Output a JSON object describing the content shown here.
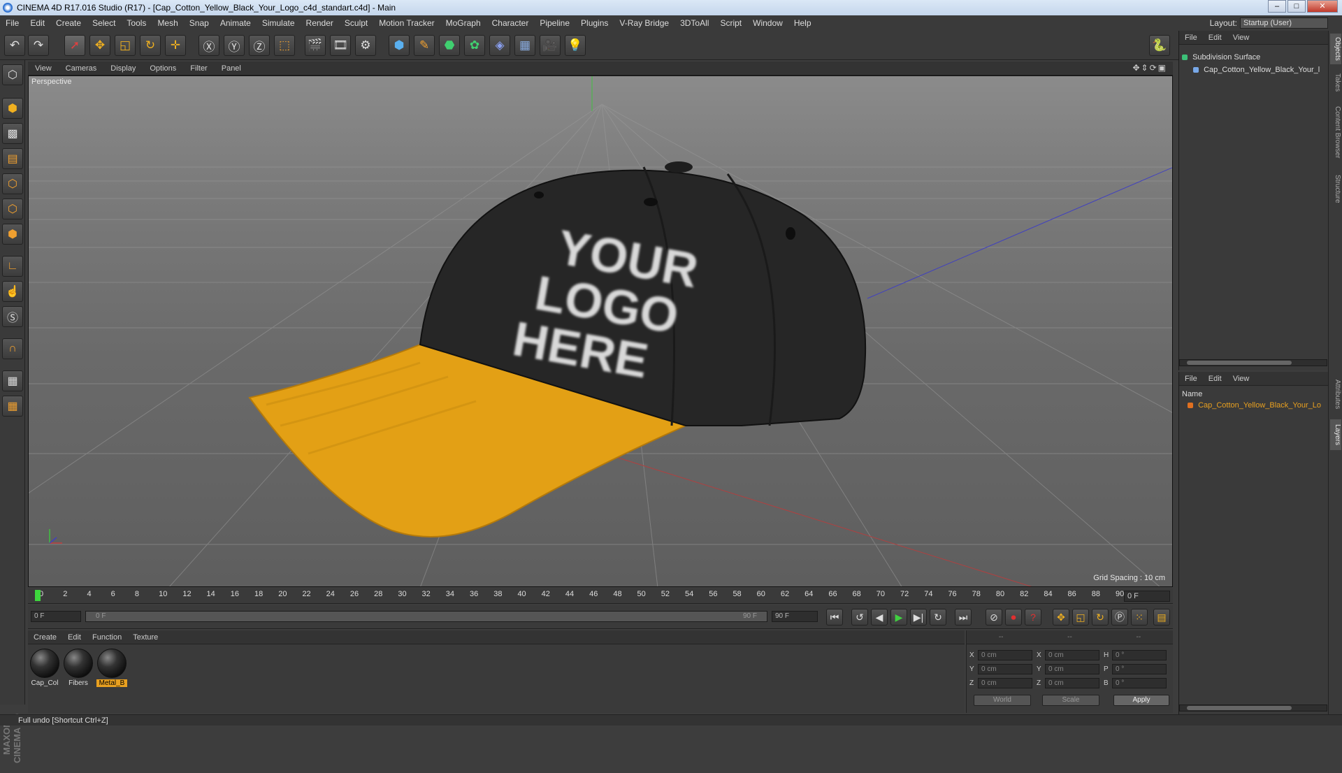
{
  "window": {
    "title": "CINEMA 4D R17.016 Studio (R17) - [Cap_Cotton_Yellow_Black_Your_Logo_c4d_standart.c4d] - Main"
  },
  "menu": [
    "File",
    "Edit",
    "Create",
    "Select",
    "Tools",
    "Mesh",
    "Snap",
    "Animate",
    "Simulate",
    "Render",
    "Sculpt",
    "Motion Tracker",
    "MoGraph",
    "Character",
    "Pipeline",
    "Plugins",
    "V-Ray Bridge",
    "3DToAll",
    "Script",
    "Window",
    "Help"
  ],
  "layout": {
    "label": "Layout:",
    "value": "Startup (User)"
  },
  "viewport": {
    "menu": [
      "View",
      "Cameras",
      "Display",
      "Options",
      "Filter",
      "Panel"
    ],
    "camera_label": "Perspective",
    "grid_spacing": "Grid Spacing : 10 cm",
    "logo_text_line1": "YOUR",
    "logo_text_line2": "LOGO",
    "logo_text_line3": "HERE"
  },
  "timeline": {
    "ticks": [
      "0",
      "2",
      "4",
      "6",
      "8",
      "10",
      "12",
      "14",
      "16",
      "18",
      "20",
      "22",
      "24",
      "26",
      "28",
      "30",
      "32",
      "34",
      "36",
      "38",
      "40",
      "42",
      "44",
      "46",
      "48",
      "50",
      "52",
      "54",
      "56",
      "58",
      "60",
      "62",
      "64",
      "66",
      "68",
      "70",
      "72",
      "74",
      "76",
      "78",
      "80",
      "82",
      "84",
      "86",
      "88",
      "90"
    ],
    "current_frame": "0 F"
  },
  "transport": {
    "start_field": "0 F",
    "slider_left": "0 F",
    "slider_right": "90 F",
    "end_field": "90 F"
  },
  "materials": {
    "menu": [
      "Create",
      "Edit",
      "Function",
      "Texture"
    ],
    "items": [
      {
        "name": "Cap_Col",
        "selected": false
      },
      {
        "name": "Fibers",
        "selected": false
      },
      {
        "name": "Metal_B",
        "selected": true
      }
    ]
  },
  "coords": {
    "headers": [
      "--",
      "--",
      "--"
    ],
    "rows": [
      {
        "a1": "X",
        "v1": "0 cm",
        "a2": "X",
        "v2": "0 cm",
        "a3": "H",
        "v3": "0 °"
      },
      {
        "a1": "Y",
        "v1": "0 cm",
        "a2": "Y",
        "v2": "0 cm",
        "a3": "P",
        "v3": "0 °"
      },
      {
        "a1": "Z",
        "v1": "0 cm",
        "a2": "Z",
        "v2": "0 cm",
        "a3": "B",
        "v3": "0 °"
      }
    ],
    "world": "World",
    "scale": "Scale",
    "apply": "Apply"
  },
  "objects": {
    "menu": [
      "File",
      "Edit",
      "View"
    ],
    "items": [
      "Subdivision Surface",
      "Cap_Cotton_Yellow_Black_Your_l"
    ]
  },
  "layers": {
    "menu": [
      "File",
      "Edit",
      "View"
    ],
    "col_name": "Name",
    "items": [
      "Cap_Cotton_Yellow_Black_Your_Lo"
    ]
  },
  "sidetabs": [
    "Objects",
    "Takes",
    "Content Browser",
    "Structure",
    "Attributes",
    "Layers"
  ],
  "status": "Full undo [Shortcut Ctrl+Z]",
  "colors": {
    "cap_black": "#2a2a2a",
    "visor_yellow": "#e8a318",
    "accent_orange": "#e8a020"
  }
}
